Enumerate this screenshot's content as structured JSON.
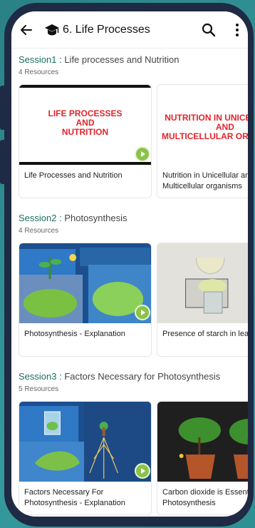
{
  "app": {
    "title": "6. Life Processes"
  },
  "sessions": [
    {
      "num": "Session1 : ",
      "name": "Life processes and Nutrition",
      "count": "4 Resources",
      "cards": [
        {
          "label": "Life Processes and Nutrition",
          "thumb_text_line1": "LIFE PROCESSES",
          "thumb_text_line2": "AND",
          "thumb_text_line3": "NUTRITION"
        },
        {
          "label": "Nutrition in Unicellular and Multicellular organisms",
          "thumb_text_line1": "NUTRITION IN UNICELLULAR",
          "thumb_text_line2": "AND",
          "thumb_text_line3": "MULTICELLULAR ORGANISMS"
        }
      ]
    },
    {
      "num": "Session2 : ",
      "name": "Photosynthesis",
      "count": "4 Resources",
      "cards": [
        {
          "label": "Photosynthesis - Explanation"
        },
        {
          "label": "Presence of starch in leaves"
        }
      ]
    },
    {
      "num": "Session3 : ",
      "name": "Factors Necessary for Photosynthesis",
      "count": "5 Resources",
      "cards": [
        {
          "label": "Factors Necessary For Photosynthesis - Explanation"
        },
        {
          "label": "Carbon dioxide is Essential for Photosynthesis"
        }
      ]
    }
  ],
  "colors": {
    "accent": "#1d6e62",
    "play": "#8bc34a",
    "frame": "#1f2a44",
    "background": "#2f8f93"
  },
  "icons": {
    "back": "arrow-left-icon",
    "cap": "graduation-cap-icon",
    "search": "search-icon",
    "more": "more-vertical-icon",
    "play": "play-icon"
  }
}
